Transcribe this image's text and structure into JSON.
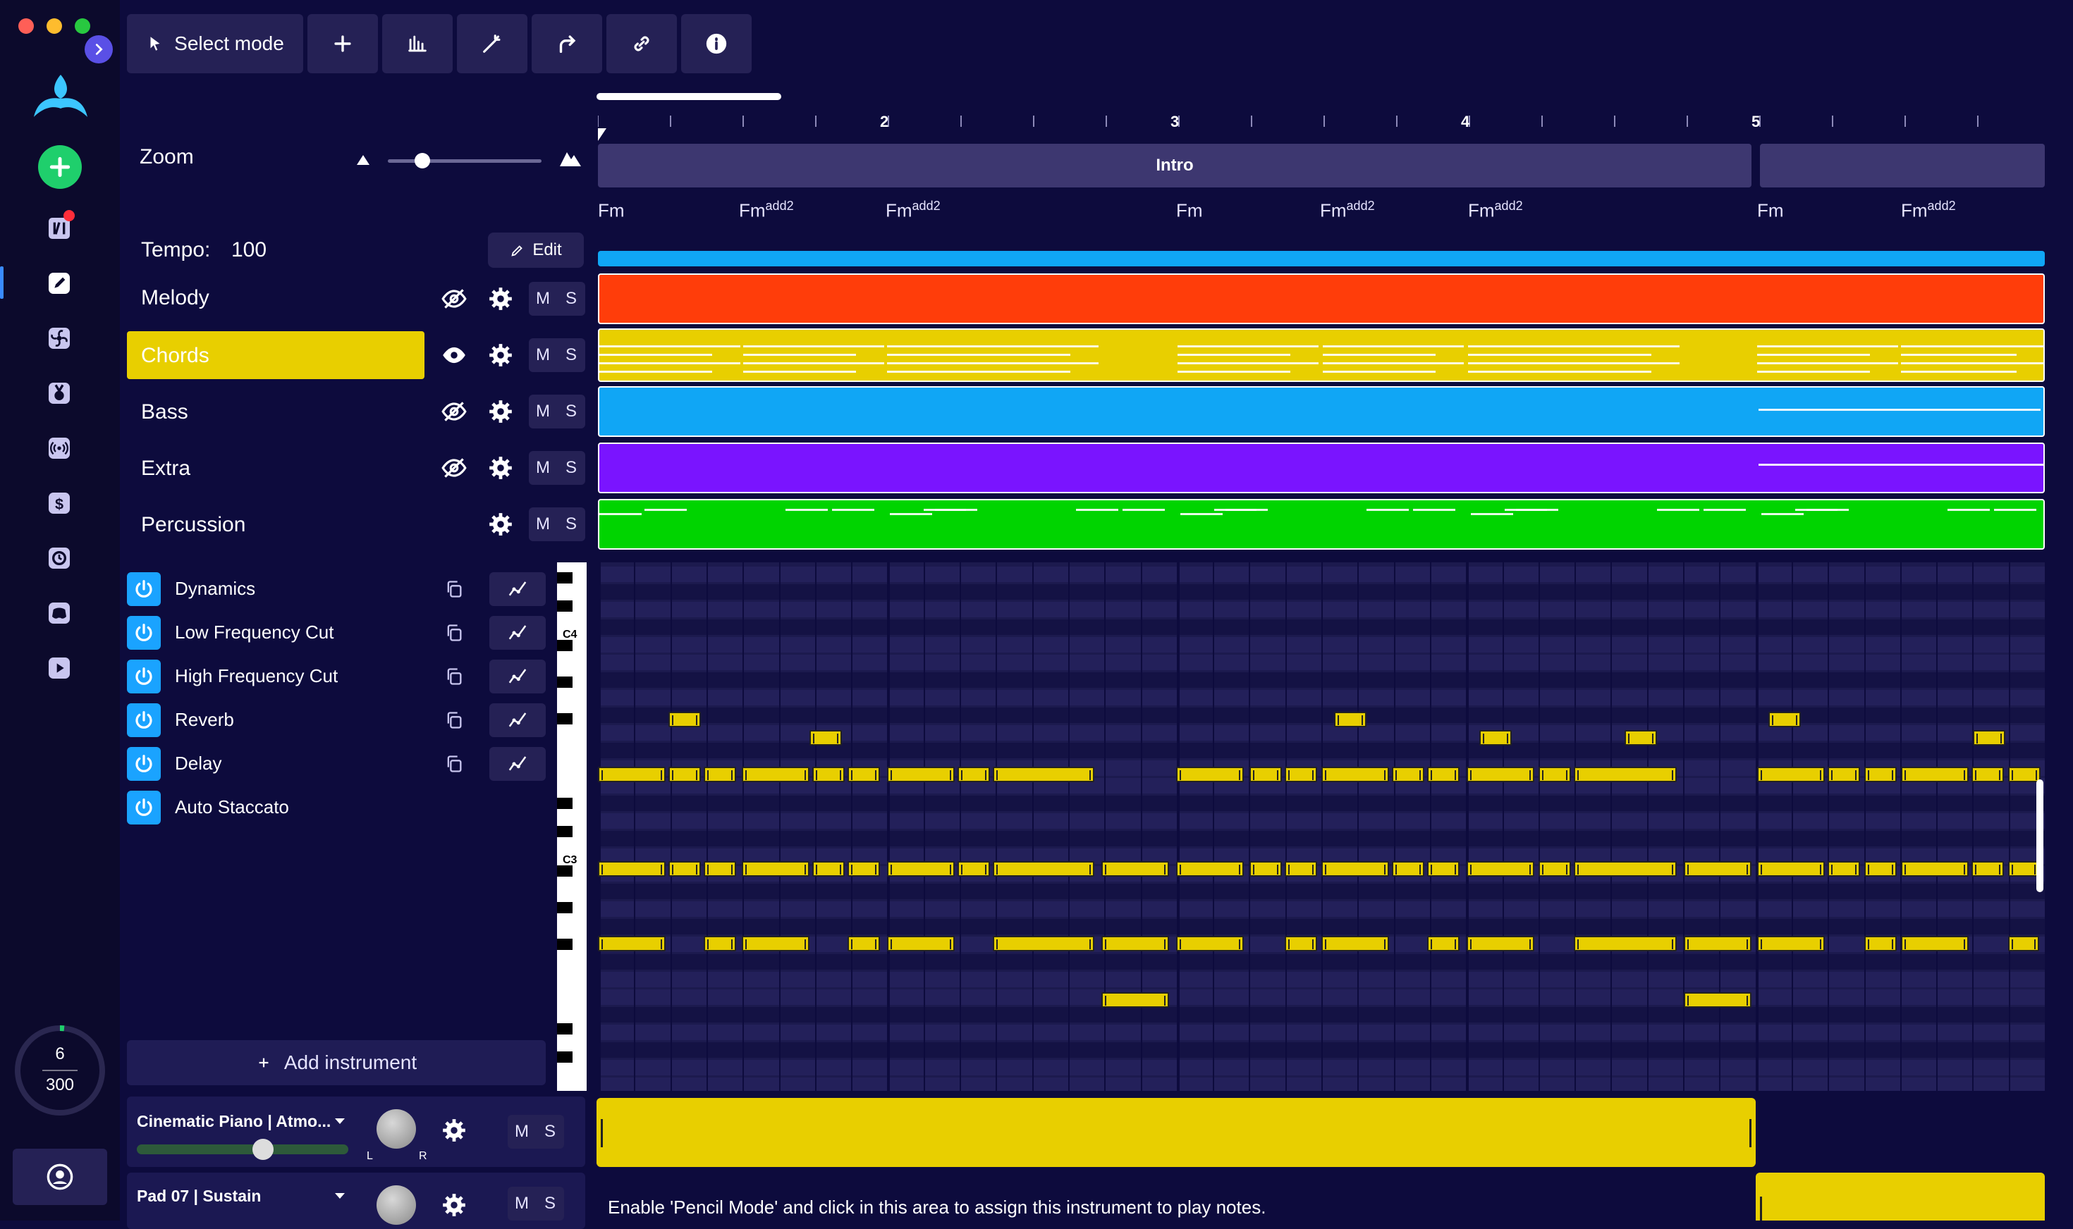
{
  "toolbar": {
    "select_mode_label": "Select mode"
  },
  "zoom": {
    "label": "Zoom",
    "level": 0.2
  },
  "tempo": {
    "label": "Tempo:",
    "value": "100",
    "edit_label": "Edit"
  },
  "tracks": [
    {
      "name": "Melody",
      "visible": false
    },
    {
      "name": "Chords",
      "visible": true,
      "selected": true
    },
    {
      "name": "Bass",
      "visible": false
    },
    {
      "name": "Extra",
      "visible": false
    },
    {
      "name": "Percussion",
      "visible": null
    }
  ],
  "ms": {
    "mute": "M",
    "solo": "S"
  },
  "effects": [
    {
      "name": "Dynamics"
    },
    {
      "name": "Low Frequency Cut"
    },
    {
      "name": "High Frequency Cut"
    },
    {
      "name": "Reverb"
    },
    {
      "name": "Delay"
    },
    {
      "name": "Auto Staccato"
    }
  ],
  "add_instrument_label": "Add instrument",
  "instruments": [
    {
      "name": "Cinematic Piano | Atmo...",
      "pan_left": "L",
      "pan_right": "R"
    },
    {
      "name": "Pad 07 | Sustain"
    }
  ],
  "usage": {
    "current": "6",
    "total": "300"
  },
  "timeline": {
    "bar_numbers": [
      "2",
      "3",
      "4",
      "5"
    ],
    "section_label": "Intro",
    "chords": [
      {
        "root": "Fm",
        "ext": ""
      },
      {
        "root": "Fm",
        "ext": "add2"
      },
      {
        "root": "Fm",
        "ext": "add2"
      },
      {
        "root": "Fm",
        "ext": ""
      },
      {
        "root": "Fm",
        "ext": "add2"
      },
      {
        "root": "Fm",
        "ext": "add2"
      },
      {
        "root": "Fm",
        "ext": ""
      },
      {
        "root": "Fm",
        "ext": "add2"
      }
    ],
    "piano_keys": [
      "C4",
      "C3"
    ],
    "hint": "Enable 'Pencil Mode' and click in this area to assign this instrument to play notes."
  },
  "colors": {
    "melody": "#ff3d0a",
    "chords": "#e8cf00",
    "bass": "#10a6f5",
    "extra": "#7a14ff",
    "percussion": "#00d400",
    "accent": "#1aa3ff",
    "add_button": "#1fcf6c"
  },
  "icons": [
    "logo-icon",
    "plus-icon",
    "arrangement-icon",
    "pencil-icon",
    "fan-icon",
    "medal-icon",
    "broadcast-icon",
    "dollar-icon",
    "history-icon",
    "discord-icon",
    "play-icon",
    "user-icon"
  ]
}
